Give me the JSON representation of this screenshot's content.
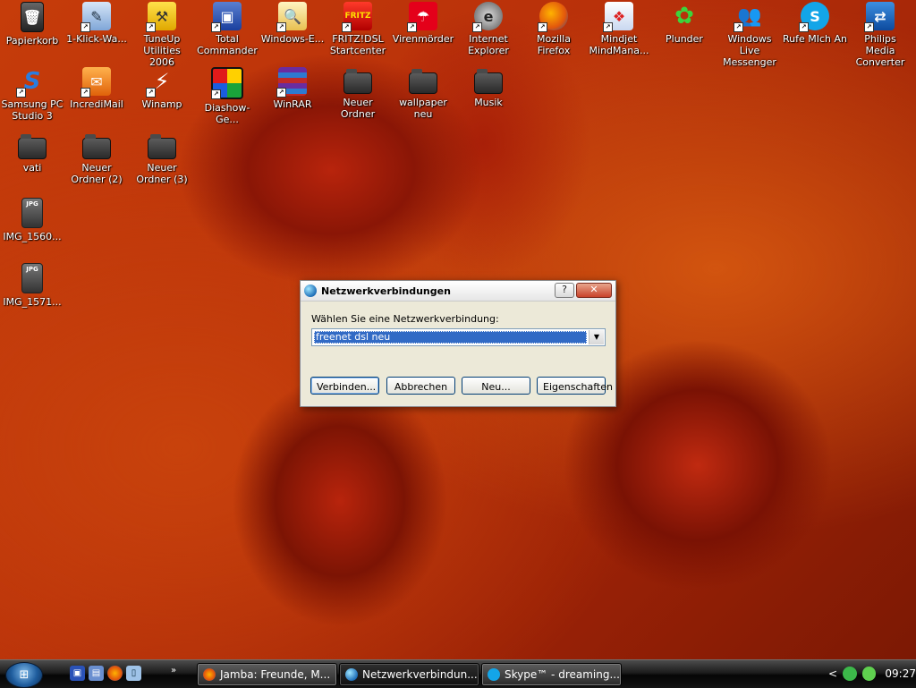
{
  "desktop": {
    "icons": [
      {
        "label": "Papierkorb",
        "icon": "recycle-bin-icon"
      },
      {
        "label": "1-Klick-Wa...",
        "icon": "maintenance-icon"
      },
      {
        "label": "TuneUp Utilities 2006",
        "icon": "tuneup-icon"
      },
      {
        "label": "Total Commander",
        "icon": "floppy-disk-icon"
      },
      {
        "label": "Windows-E...",
        "icon": "search-magnifier-icon"
      },
      {
        "label": "FRITZ!DSL Startcenter",
        "icon": "fritz-icon"
      },
      {
        "label": "Virenmörder",
        "icon": "avira-umbrella-icon"
      },
      {
        "label": "Internet Explorer",
        "icon": "internet-explorer-icon"
      },
      {
        "label": "Mozilla Firefox",
        "icon": "firefox-icon"
      },
      {
        "label": "Mindjet MindMana...",
        "icon": "mindmanager-icon"
      },
      {
        "label": "Plunder",
        "icon": "icq-flower-icon"
      },
      {
        "label": "Windows Live Messenger",
        "icon": "messenger-icon"
      },
      {
        "label": "Rufe MIch An",
        "icon": "skype-icon"
      },
      {
        "label": "Philips Media Converter",
        "icon": "media-converter-icon"
      },
      {
        "label": "Samsung PC Studio 3",
        "icon": "samsung-studio-icon"
      },
      {
        "label": "IncrediMail",
        "icon": "mail-envelope-icon"
      },
      {
        "label": "Winamp",
        "icon": "winamp-icon"
      },
      {
        "label": "Diashow-Ge...",
        "icon": "slideshow-icon"
      },
      {
        "label": "WinRAR",
        "icon": "winrar-icon"
      },
      {
        "label": "Neuer Ordner",
        "icon": "folder-icon"
      },
      {
        "label": "wallpaper neu",
        "icon": "folder-icon"
      },
      {
        "label": "Musik",
        "icon": "folder-icon"
      },
      {
        "label": "vati",
        "icon": "folder-icon"
      },
      {
        "label": "Neuer Ordner (2)",
        "icon": "folder-icon"
      },
      {
        "label": "Neuer Ordner (3)",
        "icon": "folder-icon"
      },
      {
        "label": "IMG_1560...",
        "icon": "jpg-file-icon"
      },
      {
        "label": "IMG_1571...",
        "icon": "jpg-file-icon"
      }
    ]
  },
  "dialog": {
    "title": "Netzwerkverbindungen",
    "help": "?",
    "close": "✕",
    "prompt": "Wählen Sie eine Netzwerkverbindung:",
    "selected_connection": "freenet dsl neu",
    "buttons": {
      "connect": "Verbinden...",
      "cancel": "Abbrechen",
      "new": "Neu...",
      "properties": "Eigenschaften"
    }
  },
  "taskbar": {
    "more": "»",
    "tasks": [
      {
        "label": "Jamba: Freunde, M...",
        "icon": "firefox-icon"
      },
      {
        "label": "Netzwerkverbindun...",
        "icon": "network-globe-icon"
      },
      {
        "label": "Skype™ - dreaming...",
        "icon": "skype-icon"
      }
    ],
    "tray_chevron": "<",
    "clock": "09:27"
  }
}
